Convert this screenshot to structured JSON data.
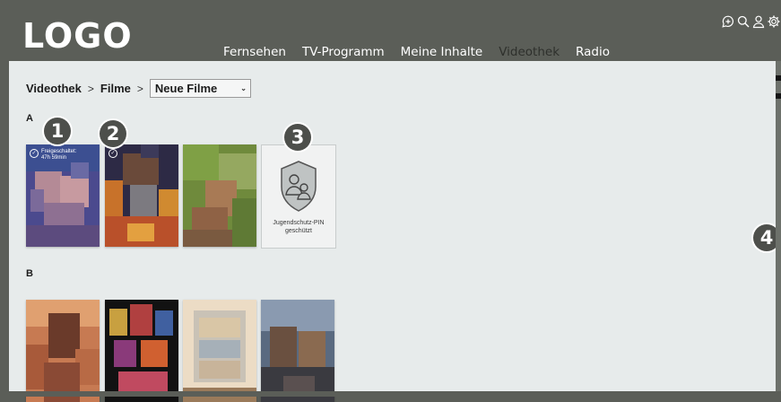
{
  "header": {
    "logo": "LOGO",
    "nav": [
      {
        "label": "Fernsehen",
        "active": false
      },
      {
        "label": "TV-Programm",
        "active": false
      },
      {
        "label": "Meine Inhalte",
        "active": false
      },
      {
        "label": "Videothek",
        "active": true
      },
      {
        "label": "Radio",
        "active": false
      }
    ],
    "icons": [
      "chat-plus-icon",
      "search-icon",
      "user-icon",
      "gear-icon"
    ]
  },
  "breadcrumb": {
    "items": [
      "Videothek",
      "Filme"
    ],
    "dropdown_value": "Neue Filme"
  },
  "sections": [
    {
      "title": "A"
    },
    {
      "title": "B"
    }
  ],
  "tiles": {
    "a1": {
      "badge": "Freigeschaltet:",
      "badge_time": "47h 59min"
    },
    "pin": {
      "label_line1": "Jugendschutz-PIN",
      "label_line2": "geschützt"
    }
  },
  "markers": [
    "1",
    "2",
    "3",
    "4"
  ],
  "colors": {
    "header_bg": "#5b5e58",
    "content_bg": "#e7ebeb",
    "active_nav": "#2e302c",
    "marker_bg": "#4d4f4b"
  }
}
